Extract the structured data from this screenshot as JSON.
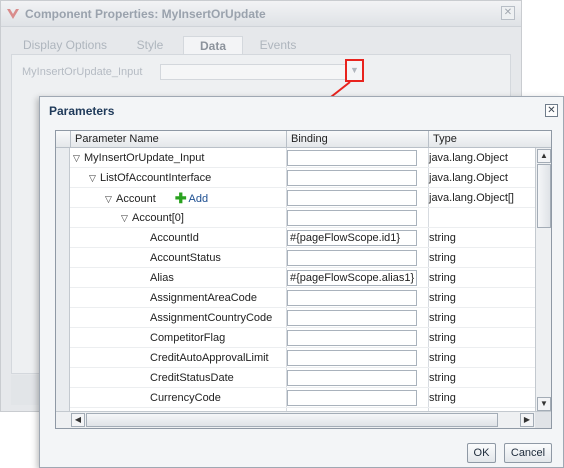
{
  "background_dialog": {
    "title": "Component Properties: MyInsertOrUpdate",
    "tabs": [
      {
        "label": "Display Options"
      },
      {
        "label": "Style"
      },
      {
        "label": "Data"
      },
      {
        "label": "Events"
      }
    ],
    "active_tab": "Data",
    "field_label": "MyInsertOrUpdate_Input",
    "field_value": ""
  },
  "dialog": {
    "title": "Parameters",
    "columns": {
      "name": "Parameter Name",
      "binding": "Binding",
      "type": "Type"
    },
    "add_label": "Add",
    "rows": [
      {
        "name": "MyInsertOrUpdate_Input",
        "binding": "",
        "type": "java.lang.Object",
        "expanded": true
      },
      {
        "name": "ListOfAccountInterface",
        "binding": "",
        "type": "java.lang.Object",
        "expanded": true
      },
      {
        "name": "Account",
        "binding": "",
        "type": "java.lang.Object[]",
        "expanded": true
      },
      {
        "name": "Account[0]",
        "binding": "",
        "type": "",
        "expanded": true
      },
      {
        "name": "AccountId",
        "binding": "#{pageFlowScope.id1}",
        "type": "string"
      },
      {
        "name": "AccountStatus",
        "binding": "",
        "type": "string"
      },
      {
        "name": "Alias",
        "binding": "#{pageFlowScope.alias1}",
        "type": "string"
      },
      {
        "name": "AssignmentAreaCode",
        "binding": "",
        "type": "string"
      },
      {
        "name": "AssignmentCountryCode",
        "binding": "",
        "type": "string"
      },
      {
        "name": "CompetitorFlag",
        "binding": "",
        "type": "string"
      },
      {
        "name": "CreditAutoApprovalLimit",
        "binding": "",
        "type": "string"
      },
      {
        "name": "CreditStatusDate",
        "binding": "",
        "type": "string"
      },
      {
        "name": "CurrencyCode",
        "binding": "",
        "type": "string"
      }
    ],
    "ok_label": "OK",
    "cancel_label": "Cancel"
  },
  "colors": {
    "highlight_box": "#e8231e",
    "title_text": "#1f3a5a",
    "add_plus": "#2aa21f"
  }
}
